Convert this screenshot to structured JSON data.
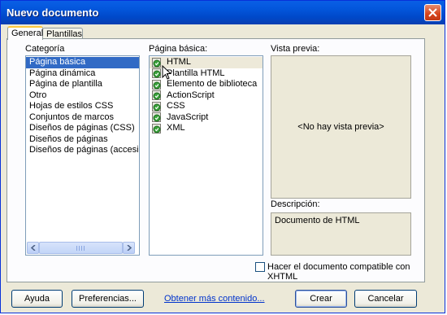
{
  "window": {
    "title": "Nuevo documento"
  },
  "tabs": [
    {
      "label": "General"
    },
    {
      "label": "Plantillas"
    }
  ],
  "categoria": {
    "label": "Categoría",
    "items": [
      "Página básica",
      "Página dinámica",
      "Página de plantilla",
      "Otro",
      "Hojas de estilos CSS",
      "Conjuntos de marcos",
      "Diseños de páginas (CSS)",
      "Diseños de páginas",
      "Diseños de páginas (accesibles)"
    ]
  },
  "basica": {
    "label": "Página básica:",
    "items": [
      "HTML",
      "Plantilla HTML",
      "Elemento de biblioteca",
      "ActionScript",
      "CSS",
      "JavaScript",
      "XML"
    ]
  },
  "preview": {
    "label": "Vista previa:",
    "text": "<No hay vista previa>"
  },
  "description": {
    "label": "Descripción:",
    "text": "Documento de HTML"
  },
  "xhtml": {
    "label": "Hacer el documento compatible con XHTML",
    "checked": false
  },
  "buttons": {
    "help": "Ayuda",
    "prefs": "Preferencias...",
    "more": "Obtener más contenido...",
    "create": "Crear",
    "cancel": "Cancelar"
  },
  "colors": {
    "selection": "#316ac5",
    "title_bar": "#0356db",
    "link": "#0033cc"
  }
}
